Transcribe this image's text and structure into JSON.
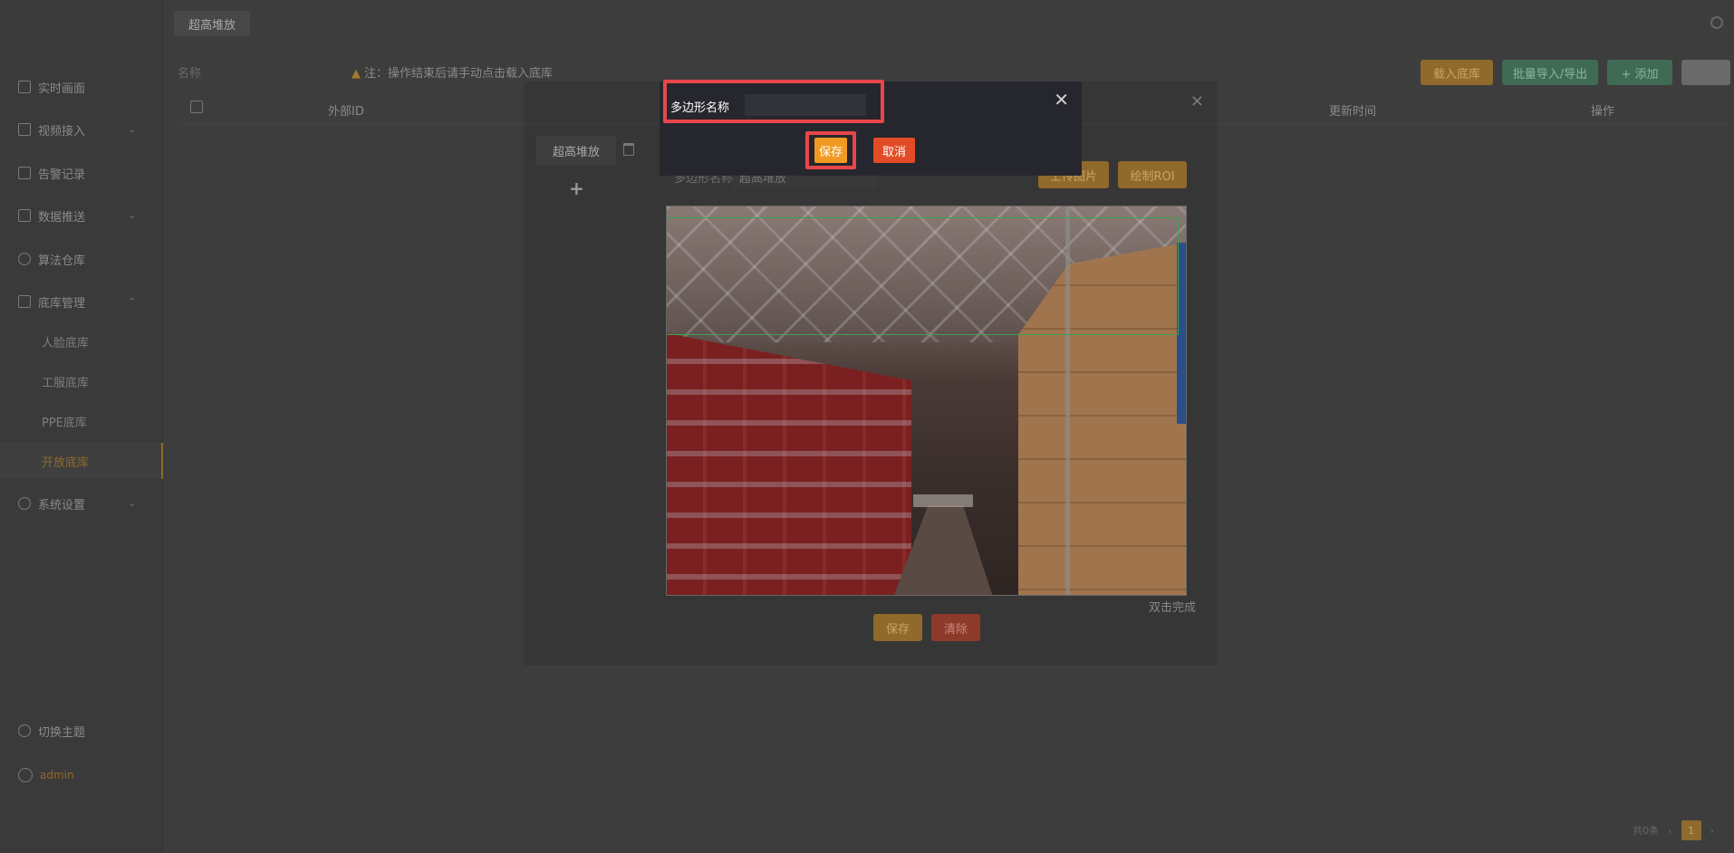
{
  "topbar": {
    "tab_label": "超高堆放"
  },
  "sidebar": {
    "items": [
      {
        "label": "实时画面"
      },
      {
        "label": "视频接入"
      },
      {
        "label": "告警记录"
      },
      {
        "label": "数据推送"
      },
      {
        "label": "算法仓库"
      },
      {
        "label": "底库管理"
      },
      {
        "label": "系统设置"
      }
    ],
    "sub_items": [
      {
        "label": "人脸底库"
      },
      {
        "label": "工服底库"
      },
      {
        "label": "PPE底库"
      },
      {
        "label": "开放底库"
      }
    ],
    "theme_toggle": "切换主题",
    "user": "admin"
  },
  "filter": {
    "name_label": "名称",
    "note": "注：操作结束后请手动点击载入底库"
  },
  "toolbar": {
    "load_label": "载入底库",
    "batch_label": "批量导入/导出",
    "add_label": "+ 添加"
  },
  "table": {
    "columns": [
      "外部ID",
      "更新时间",
      "操作"
    ]
  },
  "pagination": {
    "total": "共0条",
    "current": "1"
  },
  "editor": {
    "roi_tab": "超高堆放",
    "poly_label": "多边形名称",
    "poly_value": "超高堆放",
    "upload_label": "上传图片",
    "draw_label": "绘制ROI",
    "hint": "双击完成",
    "save_label": "保存",
    "clear_label": "清除"
  },
  "popup": {
    "label": "多边形名称",
    "input_value": "",
    "save_label": "保存",
    "cancel_label": "取消"
  },
  "colors": {
    "accent": "#f19a22",
    "danger": "#e24b25",
    "highlight": "#e8474a",
    "roi": "#3fa04f"
  }
}
